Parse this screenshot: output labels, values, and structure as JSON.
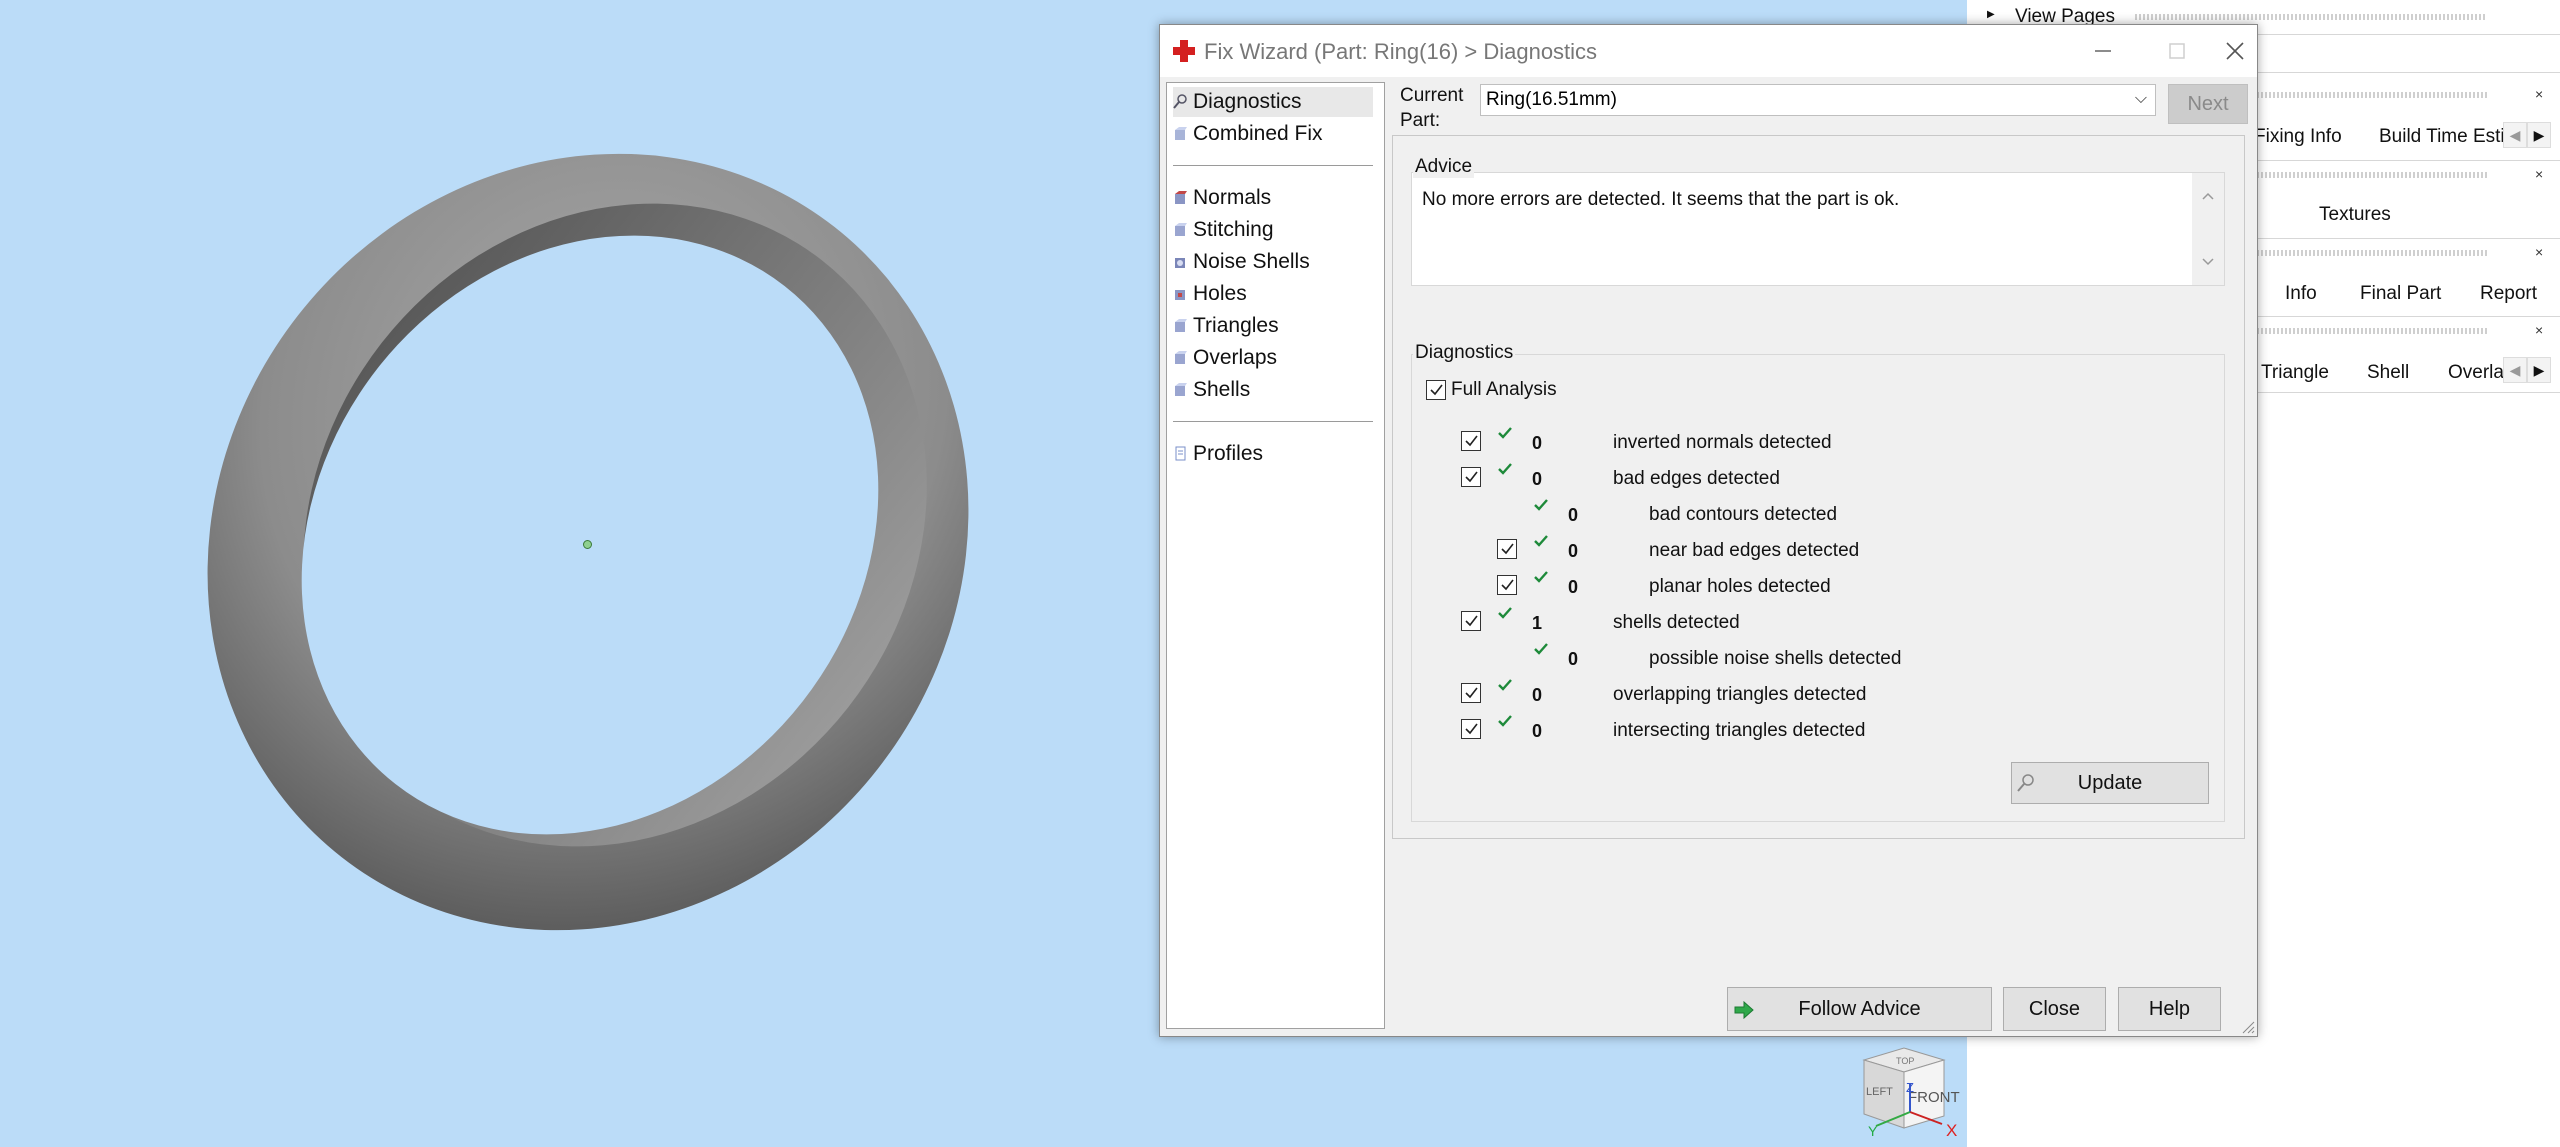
{
  "right_panel": {
    "view_pages": "View Pages",
    "row2_tabs": [
      "Fixing Info",
      "Build Time Esti"
    ],
    "row3_tabs": [
      "Textures"
    ],
    "row4_tabs": [
      "Info",
      "Final Part",
      "Report"
    ],
    "row5_tabs": [
      "Triangle",
      "Shell",
      "Overla"
    ]
  },
  "dialog": {
    "title": "Fix Wizard (Part: Ring(16) > Diagnostics",
    "nav_top": [
      "Diagnostics",
      "Combined Fix"
    ],
    "nav_mid": [
      "Normals",
      "Stitching",
      "Noise Shells",
      "Holes",
      "Triangles",
      "Overlaps",
      "Shells"
    ],
    "nav_bottom": [
      "Profiles"
    ],
    "current_part_label": "Current Part:",
    "current_part_value": "Ring(16.51mm)",
    "next_label": "Next",
    "advice_title": "Advice",
    "advice_text": "No more errors are detected. It seems that the part is ok.",
    "diagnostics_title": "Diagnostics",
    "full_analysis_label": "Full Analysis",
    "rows": [
      {
        "checkbox": true,
        "count": "0",
        "text": "inverted normals detected",
        "indent": 0
      },
      {
        "checkbox": true,
        "count": "0",
        "text": "bad edges detected",
        "indent": 0
      },
      {
        "checkbox": false,
        "count": "0",
        "text": "bad contours detected",
        "indent": 1
      },
      {
        "checkbox": true,
        "count": "0",
        "text": "near bad edges detected",
        "indent": 1
      },
      {
        "checkbox": true,
        "count": "0",
        "text": "planar holes detected",
        "indent": 1
      },
      {
        "checkbox": true,
        "count": "1",
        "text": "shells detected",
        "indent": 0
      },
      {
        "checkbox": false,
        "count": "0",
        "text": "possible noise shells detected",
        "indent": 1
      },
      {
        "checkbox": true,
        "count": "0",
        "text": "overlapping triangles detected",
        "indent": 0
      },
      {
        "checkbox": true,
        "count": "0",
        "text": "intersecting triangles detected",
        "indent": 0
      }
    ],
    "update_label": "Update",
    "follow_advice_label": "Follow Advice",
    "close_label": "Close",
    "help_label": "Help"
  },
  "navcube": {
    "top": "TOP",
    "front": "FRONT",
    "left": "LEFT",
    "z": "Z",
    "x": "X",
    "y": "Y"
  },
  "colors": {
    "viewport_bg": "#bbdcf8",
    "check_green": "#1e8a3a",
    "title_icon_red": "#d42020"
  }
}
